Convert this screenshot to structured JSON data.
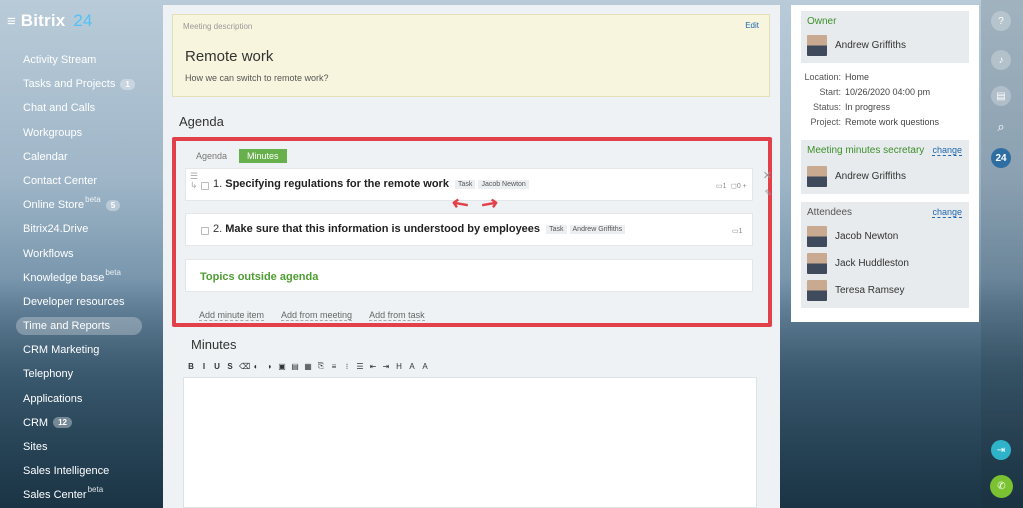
{
  "app": {
    "logo": "Bitrix",
    "logo_num": "24"
  },
  "sidebar": {
    "items": [
      {
        "label": "Activity Stream"
      },
      {
        "label": "Tasks and Projects",
        "badge": "1"
      },
      {
        "label": "Chat and Calls"
      },
      {
        "label": "Workgroups"
      },
      {
        "label": "Calendar"
      },
      {
        "label": "Contact Center"
      },
      {
        "label": "Online Store",
        "sup": "beta",
        "badge": "5"
      },
      {
        "label": "Bitrix24.Drive"
      },
      {
        "label": "Workflows"
      },
      {
        "label": "Knowledge base",
        "sup": "beta"
      },
      {
        "label": "Developer resources"
      },
      {
        "label": "Time and Reports",
        "active": true
      },
      {
        "label": "CRM Marketing"
      },
      {
        "label": "Telephony"
      },
      {
        "label": "Applications"
      },
      {
        "label": "CRM",
        "badge": "12"
      },
      {
        "label": "Sites"
      },
      {
        "label": "Sales Intelligence"
      },
      {
        "label": "Sales Center",
        "sup": "beta"
      }
    ]
  },
  "meeting": {
    "desc_header": "Meeting description",
    "edit": "Edit",
    "title": "Remote work",
    "text": "How we can switch to remote work?"
  },
  "agenda": {
    "header": "Agenda",
    "tabs": [
      "Agenda",
      "Minutes"
    ],
    "items": [
      {
        "num": "1.",
        "title": "Specifying regulations for the remote work",
        "tags": [
          "Task",
          "Jacob Newton"
        ],
        "meta": "1",
        "meta2": "0 +"
      },
      {
        "num": "2.",
        "title": "Make sure that this information is understood by employees",
        "tags": [
          "Task",
          "Andrew Griffiths"
        ],
        "meta": "1"
      }
    ],
    "topics": "Topics outside agenda",
    "links": [
      "Add minute item",
      "Add from meeting",
      "Add from task"
    ]
  },
  "minutes": {
    "header": "Minutes",
    "toolbar": [
      "B",
      "I",
      "U",
      "S",
      "⌫",
      "◐",
      "◑",
      "▣",
      "▤",
      "▦",
      "⎘",
      "≡",
      "⁝",
      "☰",
      "⇤",
      "⇥",
      "H",
      "A",
      "A"
    ]
  },
  "details": {
    "owner_label": "Owner",
    "owner": "Andrew Griffiths",
    "location_k": "Location:",
    "location_v": "Home",
    "start_k": "Start:",
    "start_v": "10/26/2020 04:00 pm",
    "status_k": "Status:",
    "status_v": "In progress",
    "project_k": "Project:",
    "project_v": "Remote work questions",
    "secretary_label": "Meeting minutes secretary",
    "secretary": "Andrew Griffiths",
    "attendees_label": "Attendees",
    "change": "change",
    "attendees": [
      "Jacob Newton",
      "Jack Huddleston",
      "Teresa Ramsey"
    ]
  },
  "rbar": {
    "count": "24"
  }
}
